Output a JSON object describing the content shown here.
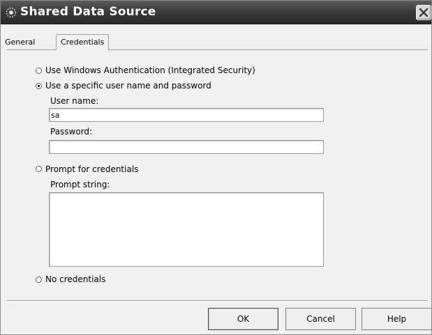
{
  "window": {
    "title": "Shared Data Source",
    "icon": "data-source-icon",
    "close_icon": "close-icon"
  },
  "tabs": [
    {
      "label": "General",
      "selected": false
    },
    {
      "label": "Credentials",
      "selected": true
    }
  ],
  "credentials": {
    "options": [
      {
        "label": "Use Windows Authentication (Integrated Security)",
        "checked": false
      },
      {
        "label": "Use a specific user name and password",
        "checked": true
      },
      {
        "label": "Prompt for credentials",
        "checked": false
      },
      {
        "label": "No credentials",
        "checked": false
      }
    ],
    "user_name_label": "User name:",
    "user_name_value": "sa",
    "password_label": "Password:",
    "password_value": "",
    "prompt_string_label": "Prompt string:",
    "prompt_string_value": ""
  },
  "buttons": {
    "ok": "OK",
    "cancel": "Cancel",
    "help": "Help"
  },
  "colors": {
    "titlebar": "#2a2a2a",
    "title_text": "#ffffff",
    "dialog_background": "#f0f0f0"
  }
}
